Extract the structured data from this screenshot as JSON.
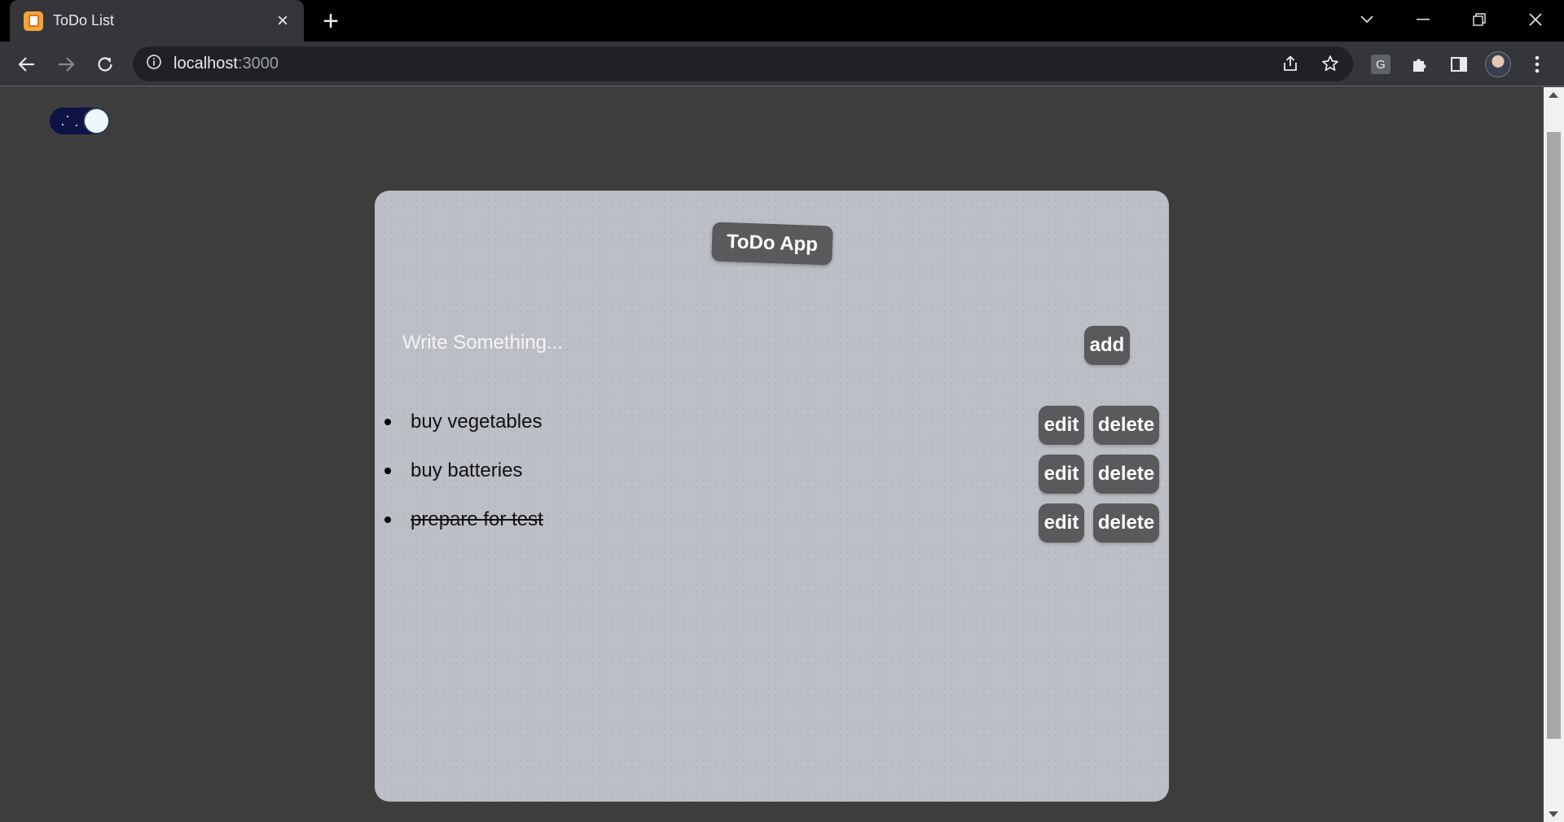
{
  "browser": {
    "tab_title": "ToDo List",
    "url_host": "localhost",
    "url_port": ":3000",
    "extension_label": "G"
  },
  "page": {
    "app_title": "ToDo App",
    "input": {
      "placeholder": "Write Something...",
      "value": ""
    },
    "add_label": "add",
    "edit_label": "edit",
    "delete_label": "delete",
    "todos": [
      {
        "text": "buy vegetables",
        "completed": false
      },
      {
        "text": "buy batteries",
        "completed": false
      },
      {
        "text": "prepare for test",
        "completed": true
      }
    ]
  },
  "colors": {
    "page_background": "#3d3d3d",
    "card_background": "#bdbfc6",
    "button_background": "#5a5a5c",
    "toggle_track": "#0e1245",
    "toggle_knob": "#eef7fb"
  },
  "icons": [
    "tab-favicon-icon",
    "close-icon",
    "plus-icon",
    "chevron-down-icon",
    "minimize-icon",
    "restore-icon",
    "window-close-icon",
    "back-arrow-icon",
    "forward-arrow-icon",
    "reload-icon",
    "info-icon",
    "share-icon",
    "star-icon",
    "puzzle-icon",
    "side-panel-icon",
    "profile-avatar",
    "more-vert-icon"
  ]
}
